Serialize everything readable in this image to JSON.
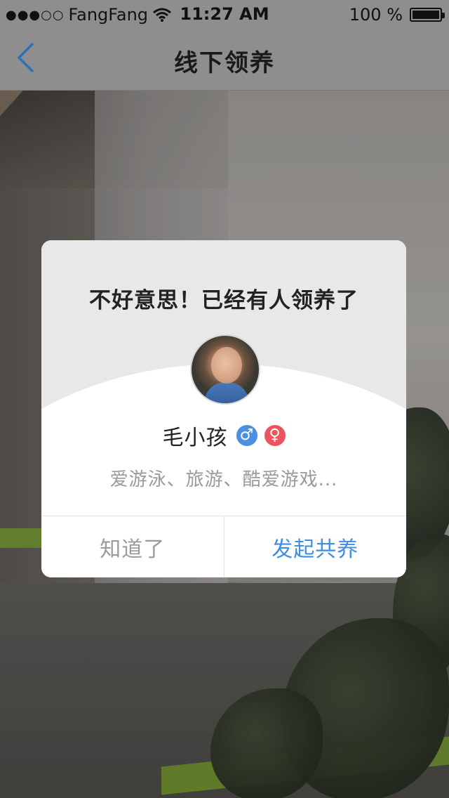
{
  "status_bar": {
    "signal": "●●●○○",
    "carrier": "FangFang",
    "time": "11:27 AM",
    "battery": "100 %"
  },
  "nav": {
    "back_icon": "chevron-left-icon",
    "title": "线下领养"
  },
  "dialog": {
    "title": "不好意思！已经有人领养了",
    "user": {
      "name": "毛小孩",
      "male_symbol": "♂",
      "female_symbol": "♀",
      "tags": "爱游泳、旅游、酷爱游戏..."
    },
    "buttons": {
      "cancel": "知道了",
      "confirm": "发起共养"
    }
  },
  "colors": {
    "accent": "#3b8ee4",
    "male": "#4a8fe0",
    "female": "#e9565f",
    "muted_text": "#9a9a9a"
  }
}
